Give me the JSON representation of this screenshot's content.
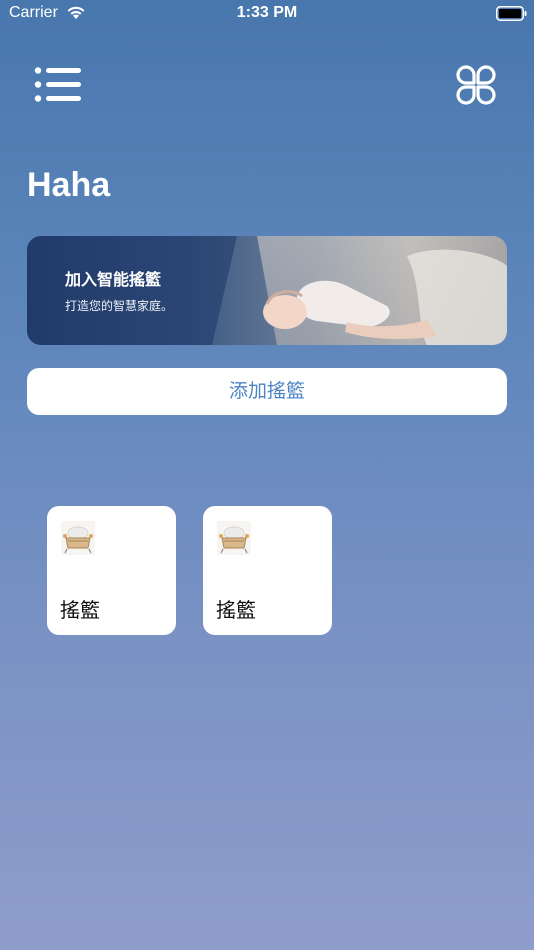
{
  "status_bar": {
    "carrier": "Carrier",
    "time": "1:33 PM"
  },
  "header": {
    "menu_icon": "list-icon",
    "apps_icon": "four-leaf-apps-icon"
  },
  "page_title": "Haha",
  "banner": {
    "title": "加入智能搖籃",
    "subtitle": "打造您的智慧家庭。"
  },
  "add_button_label": "添加搖籃",
  "devices": [
    {
      "name": "搖籃",
      "icon": "cradle-icon"
    },
    {
      "name": "搖籃",
      "icon": "cradle-icon"
    }
  ],
  "colors": {
    "background_top": "#4877ad",
    "background_bottom": "#8f9dcc",
    "accent_text": "#4d84c4",
    "card": "#ffffff"
  }
}
